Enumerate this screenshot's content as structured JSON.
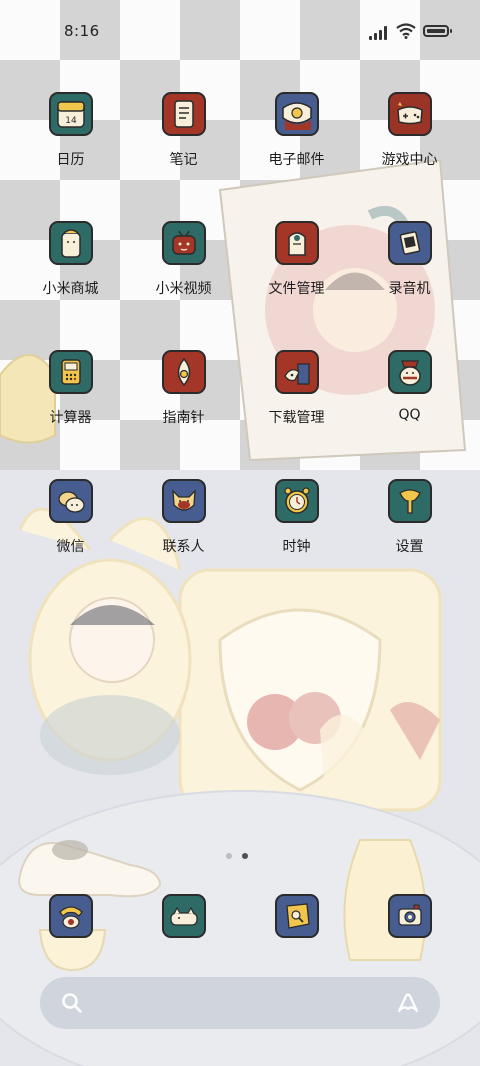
{
  "status_bar": {
    "time": "8:16"
  },
  "apps": [
    {
      "name": "日历",
      "icon": "calendar-icon",
      "bg": "#2f6b66"
    },
    {
      "name": "笔记",
      "icon": "note-icon",
      "bg": "#a33627"
    },
    {
      "name": "电子邮件",
      "icon": "mail-icon",
      "bg": "#475c8f"
    },
    {
      "name": "游戏中心",
      "icon": "game-controller-icon",
      "bg": "#9a3427"
    },
    {
      "name": "小米商城",
      "icon": "shop-icon",
      "bg": "#2f6b66"
    },
    {
      "name": "小米视频",
      "icon": "video-icon",
      "bg": "#2f6b66"
    },
    {
      "name": "文件管理",
      "icon": "folder-icon",
      "bg": "#a33627"
    },
    {
      "name": "录音机",
      "icon": "recorder-icon",
      "bg": "#475c8f"
    },
    {
      "name": "计算器",
      "icon": "calculator-icon",
      "bg": "#2f6b66"
    },
    {
      "name": "指南针",
      "icon": "compass-icon",
      "bg": "#a33627"
    },
    {
      "name": "下载管理",
      "icon": "download-icon",
      "bg": "#a33627"
    },
    {
      "name": "QQ",
      "icon": "qq-icon",
      "bg": "#2f6b66"
    },
    {
      "name": "微信",
      "icon": "wechat-icon",
      "bg": "#475c8f"
    },
    {
      "name": "联系人",
      "icon": "contacts-icon",
      "bg": "#475c8f"
    },
    {
      "name": "时钟",
      "icon": "clock-icon",
      "bg": "#2f6b66"
    },
    {
      "name": "设置",
      "icon": "settings-icon",
      "bg": "#2f6b66"
    }
  ],
  "dock": [
    {
      "icon": "phone-icon",
      "bg": "#475c8f"
    },
    {
      "icon": "messages-icon",
      "bg": "#2f6b66"
    },
    {
      "icon": "browser-icon",
      "bg": "#475c8f"
    },
    {
      "icon": "camera-icon",
      "bg": "#475c8f"
    }
  ],
  "page_dots": {
    "count": 2,
    "active": 1
  },
  "search": {
    "icon": "search-icon",
    "assistant_icon": "assistant-icon"
  }
}
